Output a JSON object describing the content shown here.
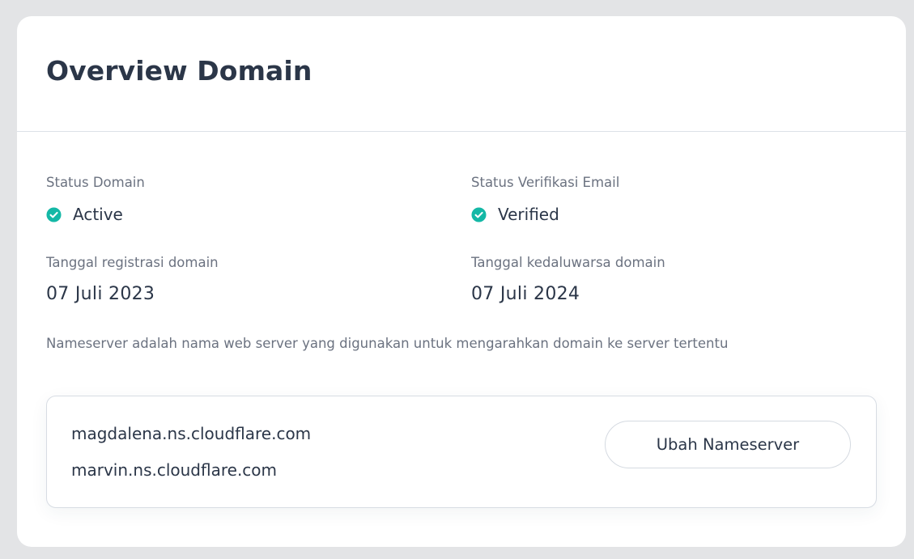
{
  "card": {
    "title": "Overview Domain"
  },
  "status_domain": {
    "label": "Status Domain",
    "value": "Active",
    "icon": "check-circle-icon"
  },
  "status_email": {
    "label": "Status Verifikasi Email",
    "value": "Verified",
    "icon": "check-circle-icon"
  },
  "registration": {
    "label": "Tanggal registrasi domain",
    "value": "07 Juli 2023"
  },
  "expiration": {
    "label": "Tanggal kedaluwarsa domain",
    "value": "07 Juli 2024"
  },
  "nameserver": {
    "description": "Nameserver adalah nama web server yang digunakan untuk mengarahkan domain ke server tertentu",
    "items": [
      "magdalena.ns.cloudflare.com",
      "marvin.ns.cloudflare.com"
    ],
    "button_label": "Ubah Nameserver"
  },
  "colors": {
    "success": "#14b8a6",
    "heading": "#2b3648",
    "muted": "#6b7280",
    "background": "#e3e4e6"
  }
}
